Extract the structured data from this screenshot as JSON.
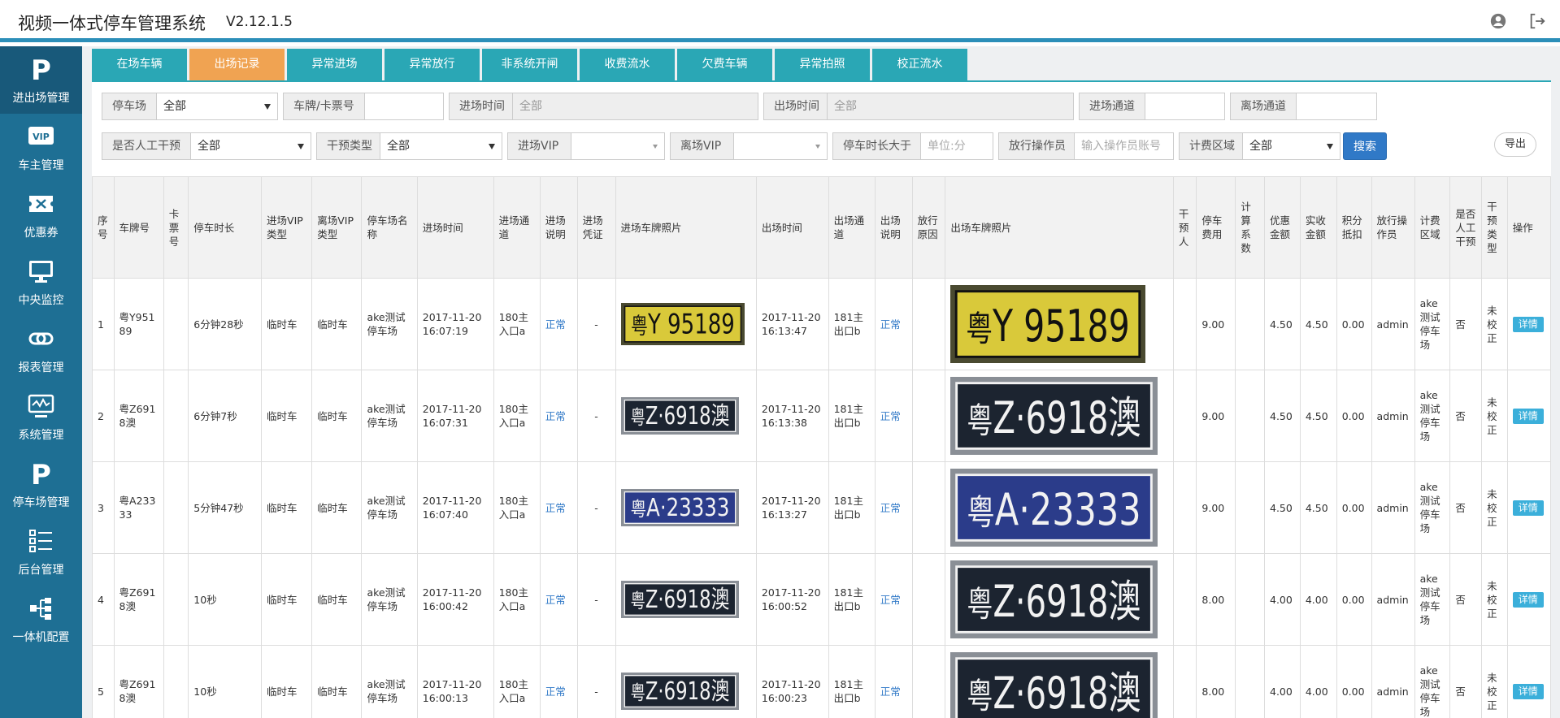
{
  "header": {
    "title": "视频一体式停车管理系统",
    "version": "V2.12.1.5",
    "user_icon": "user-circle-icon",
    "logout_icon": "logout-icon"
  },
  "sidebar": {
    "items": [
      {
        "label": "进出场管理",
        "icon": "parking-p-icon"
      },
      {
        "label": "车主管理",
        "icon": "vip-card-icon"
      },
      {
        "label": "优惠券",
        "icon": "coupon-icon"
      },
      {
        "label": "中央监控",
        "icon": "monitor-icon"
      },
      {
        "label": "报表管理",
        "icon": "link-icon"
      },
      {
        "label": "系统管理",
        "icon": "system-monitor-icon"
      },
      {
        "label": "停车场管理",
        "icon": "parking-p-icon"
      },
      {
        "label": "后台管理",
        "icon": "list-icon"
      },
      {
        "label": "一体机配置",
        "icon": "tree-icon"
      }
    ]
  },
  "tabs": [
    {
      "label": "在场车辆"
    },
    {
      "label": "出场记录"
    },
    {
      "label": "异常进场"
    },
    {
      "label": "异常放行"
    },
    {
      "label": "非系统开闸"
    },
    {
      "label": "收费流水"
    },
    {
      "label": "欠费车辆"
    },
    {
      "label": "异常拍照"
    },
    {
      "label": "校正流水"
    }
  ],
  "filters": {
    "parking_lot": {
      "label": "停车场",
      "value": "全部"
    },
    "plate_card": {
      "label": "车牌/卡票号",
      "value": ""
    },
    "entry_time": {
      "label": "进场时间",
      "placeholder": "全部"
    },
    "exit_time": {
      "label": "出场时间",
      "placeholder": "全部"
    },
    "entry_channel": {
      "label": "进场通道",
      "value": ""
    },
    "exit_channel": {
      "label": "离场通道",
      "value": ""
    },
    "manual_intervene": {
      "label": "是否人工干预",
      "value": "全部"
    },
    "intervene_type": {
      "label": "干预类型",
      "value": "全部"
    },
    "entry_vip": {
      "label": "进场VIP",
      "value": ""
    },
    "exit_vip": {
      "label": "离场VIP",
      "value": ""
    },
    "duration_gt": {
      "label": "停车时长大于",
      "placeholder": "单位:分"
    },
    "release_operator": {
      "label": "放行操作员",
      "placeholder": "输入操作员账号"
    },
    "billing_area": {
      "label": "计费区域",
      "value": "全部"
    },
    "search_label": "搜索",
    "export_label": "导出"
  },
  "table": {
    "columns": [
      "序号",
      "车牌号",
      "卡票号",
      "停车时长",
      "进场VIP类型",
      "离场VIP类型",
      "停车场名称",
      "进场时间",
      "进场通道",
      "进场说明",
      "进场凭证",
      "进场车牌照片",
      "出场时间",
      "出场通道",
      "出场说明",
      "放行原因",
      "出场车牌照片",
      "干预人",
      "停车费用",
      "计算系数",
      "优惠金额",
      "实收金额",
      "积分抵扣",
      "放行操作员",
      "计费区域",
      "是否人工干预",
      "干预类型",
      "操作"
    ],
    "detail_label": "详情",
    "rows": [
      {
        "no": "1",
        "plate": "粤Y95189",
        "card": "",
        "duration": "6分钟28秒",
        "entry_vip": "临时车",
        "exit_vip": "临时车",
        "lot": "ake测试停车场",
        "entry_time": "2017-11-20 16:07:19",
        "entry_channel": "180主入口a",
        "entry_note": "正常",
        "entry_cert": "-",
        "plate_prefix": "粤",
        "plate_body": "Y 95189",
        "plate_color": "yellow",
        "exit_time": "2017-11-20 16:13:47",
        "exit_channel": "181主出口b",
        "exit_note": "正常",
        "release_reason": "",
        "operator_person": "",
        "fee": "9.00",
        "coef": "",
        "discount": "4.50",
        "paid": "4.50",
        "points": "0.00",
        "operator": "admin",
        "area": "ake测试停车场",
        "manual": "否",
        "intervene": "未校正"
      },
      {
        "no": "2",
        "plate": "粤Z6918澳",
        "card": "",
        "duration": "6分钟7秒",
        "entry_vip": "临时车",
        "exit_vip": "临时车",
        "lot": "ake测试停车场",
        "entry_time": "2017-11-20 16:07:31",
        "entry_channel": "180主入口a",
        "entry_note": "正常",
        "entry_cert": "-",
        "plate_prefix": "粤",
        "plate_body": "Z·6918澳",
        "plate_color": "black",
        "exit_time": "2017-11-20 16:13:38",
        "exit_channel": "181主出口b",
        "exit_note": "正常",
        "release_reason": "",
        "operator_person": "",
        "fee": "9.00",
        "coef": "",
        "discount": "4.50",
        "paid": "4.50",
        "points": "0.00",
        "operator": "admin",
        "area": "ake测试停车场",
        "manual": "否",
        "intervene": "未校正"
      },
      {
        "no": "3",
        "plate": "粤A23333",
        "card": "",
        "duration": "5分钟47秒",
        "entry_vip": "临时车",
        "exit_vip": "临时车",
        "lot": "ake测试停车场",
        "entry_time": "2017-11-20 16:07:40",
        "entry_channel": "180主入口a",
        "entry_note": "正常",
        "entry_cert": "-",
        "plate_prefix": "粤",
        "plate_body": "A·23333",
        "plate_color": "blue",
        "exit_time": "2017-11-20 16:13:27",
        "exit_channel": "181主出口b",
        "exit_note": "正常",
        "release_reason": "",
        "operator_person": "",
        "fee": "9.00",
        "coef": "",
        "discount": "4.50",
        "paid": "4.50",
        "points": "0.00",
        "operator": "admin",
        "area": "ake测试停车场",
        "manual": "否",
        "intervene": "未校正"
      },
      {
        "no": "4",
        "plate": "粤Z6918澳",
        "card": "",
        "duration": "10秒",
        "entry_vip": "临时车",
        "exit_vip": "临时车",
        "lot": "ake测试停车场",
        "entry_time": "2017-11-20 16:00:42",
        "entry_channel": "180主入口a",
        "entry_note": "正常",
        "entry_cert": "-",
        "plate_prefix": "粤",
        "plate_body": "Z·6918澳",
        "plate_color": "black",
        "exit_time": "2017-11-20 16:00:52",
        "exit_channel": "181主出口b",
        "exit_note": "正常",
        "release_reason": "",
        "operator_person": "",
        "fee": "8.00",
        "coef": "",
        "discount": "4.00",
        "paid": "4.00",
        "points": "0.00",
        "operator": "admin",
        "area": "ake测试停车场",
        "manual": "否",
        "intervene": "未校正"
      },
      {
        "no": "5",
        "plate": "粤Z6918澳",
        "card": "",
        "duration": "10秒",
        "entry_vip": "临时车",
        "exit_vip": "临时车",
        "lot": "ake测试停车场",
        "entry_time": "2017-11-20 16:00:13",
        "entry_channel": "180主入口a",
        "entry_note": "正常",
        "entry_cert": "-",
        "plate_prefix": "粤",
        "plate_body": "Z·6918澳",
        "plate_color": "black",
        "exit_time": "2017-11-20 16:00:23",
        "exit_channel": "181主出口b",
        "exit_note": "正常",
        "release_reason": "",
        "operator_person": "",
        "fee": "8.00",
        "coef": "",
        "discount": "4.00",
        "paid": "4.00",
        "points": "0.00",
        "operator": "admin",
        "area": "ake测试停车场",
        "manual": "否",
        "intervene": "未校正"
      }
    ]
  },
  "colors": {
    "sidebar": "#1e6f94",
    "tab": "#2aa7b5",
    "tab_active": "#f0a352",
    "primary": "#3079c7",
    "detail_button": "#3bafda",
    "plate_yellow": "#d9c93a",
    "plate_black": "#1c2430",
    "plate_blue": "#2b3c8a"
  }
}
